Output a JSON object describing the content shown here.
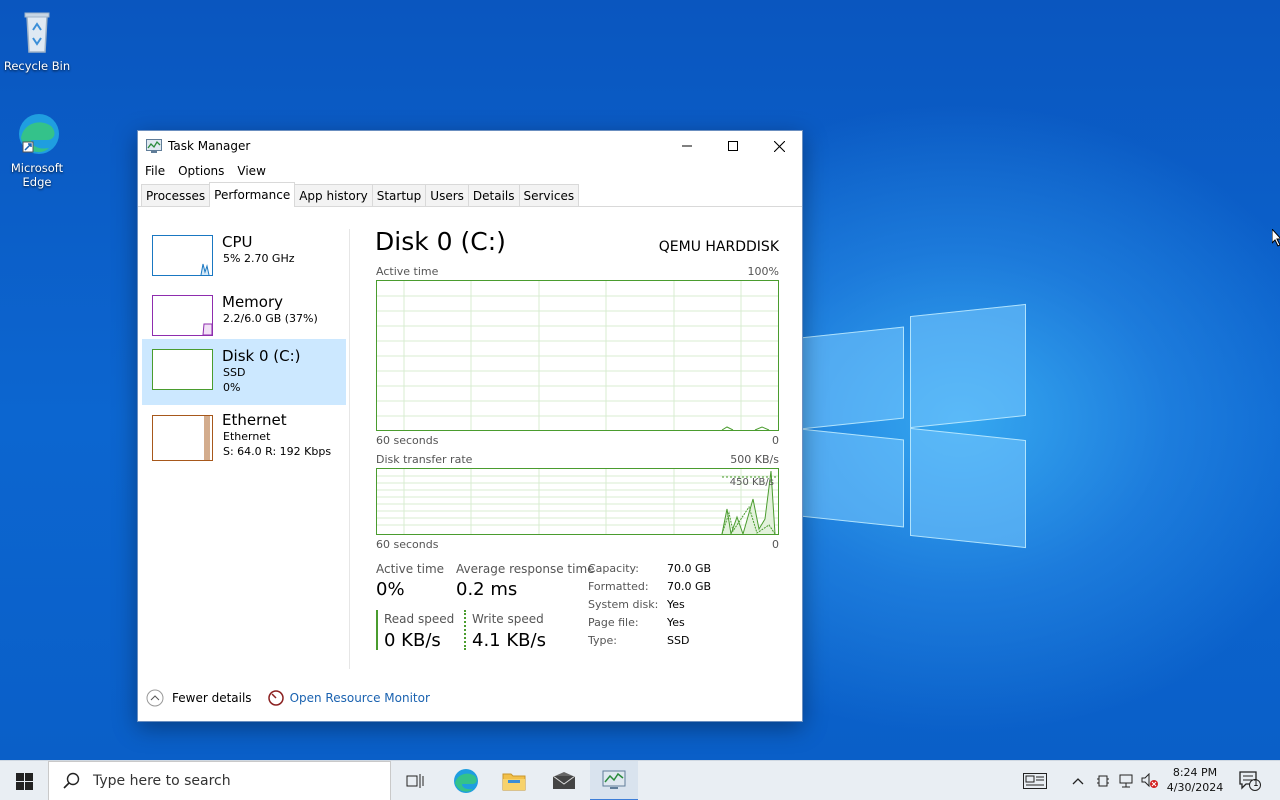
{
  "desktop": {
    "icons": [
      {
        "label": "Recycle Bin"
      },
      {
        "label": "Microsoft Edge"
      }
    ]
  },
  "window": {
    "title": "Task Manager",
    "menu": [
      "File",
      "Options",
      "View"
    ],
    "tabs": [
      "Processes",
      "Performance",
      "App history",
      "Startup",
      "Users",
      "Details",
      "Services"
    ],
    "active_tab": "Performance"
  },
  "sidebar": {
    "items": [
      {
        "name": "CPU",
        "line1": "5%  2.70 GHz",
        "line2": "",
        "color": "#1a78c2"
      },
      {
        "name": "Memory",
        "line1": "2.2/6.0 GB (37%)",
        "line2": "",
        "color": "#8e2dae"
      },
      {
        "name": "Disk 0 (C:)",
        "line1": "SSD",
        "line2": "0%",
        "color": "#4a9c2e"
      },
      {
        "name": "Ethernet",
        "line1": "Ethernet",
        "line2": "S: 64.0  R: 192 Kbps",
        "color": "#a7581b"
      }
    ],
    "selected": "Disk 0 (C:)"
  },
  "detail": {
    "title": "Disk 0 (C:)",
    "model": "QEMU HARDDISK",
    "graph1": {
      "label": "Active time",
      "max": "100%",
      "time": "60 seconds",
      "min": "0"
    },
    "graph2": {
      "label": "Disk transfer rate",
      "max": "500 KB/s",
      "inner_label": "450 KB/s",
      "time": "60 seconds",
      "min": "0"
    },
    "stats": {
      "active_time_label": "Active time",
      "active_time_value": "0%",
      "avg_response_label": "Average response time",
      "avg_response_value": "0.2 ms",
      "read_label": "Read speed",
      "read_value": "0 KB/s",
      "write_label": "Write speed",
      "write_value": "4.1 KB/s"
    },
    "properties": [
      {
        "key": "Capacity:",
        "value": "70.0 GB"
      },
      {
        "key": "Formatted:",
        "value": "70.0 GB"
      },
      {
        "key": "System disk:",
        "value": "Yes"
      },
      {
        "key": "Page file:",
        "value": "Yes"
      },
      {
        "key": "Type:",
        "value": "SSD"
      }
    ]
  },
  "footer": {
    "fewer_details": "Fewer details",
    "open_resource_monitor": "Open Resource Monitor"
  },
  "taskbar": {
    "search_placeholder": "Type here to search",
    "time": "8:24 PM",
    "date": "4/30/2024",
    "notification_count": "1"
  }
}
